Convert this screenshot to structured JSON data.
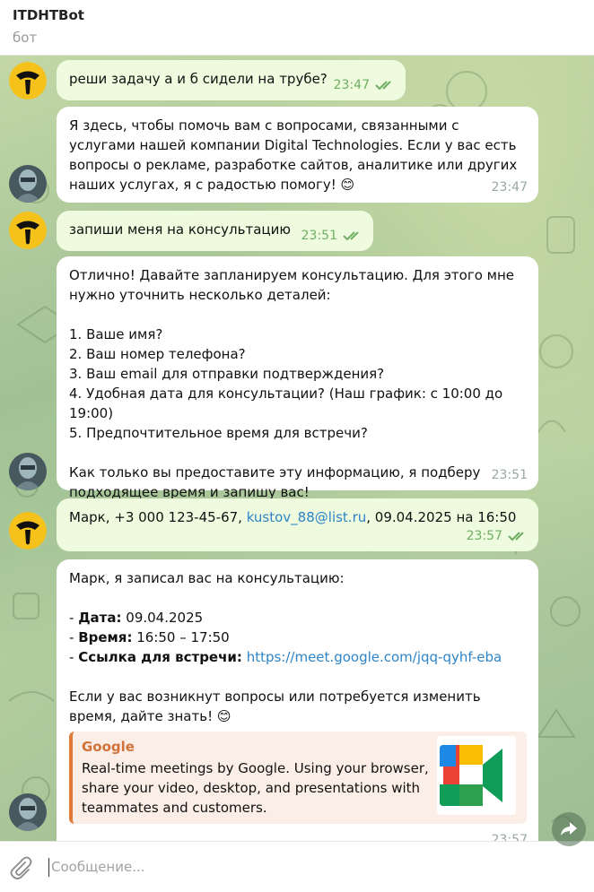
{
  "header": {
    "title": "ITDHTBot",
    "subtitle": "бот"
  },
  "messages": [
    {
      "from": "user",
      "text": "реши задачу а и б сидели на трубе?",
      "time": "23:47"
    },
    {
      "from": "bot",
      "text": "Я здесь, чтобы помочь вам с вопросами, связанными с услугами нашей компании Digital Technologies. Если у вас есть вопросы о рекламе, разработке сайтов, аналитике или других наших услугах, я с радостью помогу!",
      "emoji": "😊",
      "time": "23:47"
    },
    {
      "from": "user",
      "text": "запиши меня на консультацию",
      "time": "23:51"
    },
    {
      "from": "bot",
      "text": "Отлично! Давайте запланируем консультацию. Для этого мне нужно уточнить несколько деталей:\n\n1. Ваше имя?\n2. Ваш номер телефона?\n3. Ваш email для отправки подтверждения?\n4. Удобная дата для консультации? (Наш график: с 10:00 до 19:00)\n5. Предпочтительное время для встречи?\n\nКак только вы предоставите эту информацию, я подберу подходящее время и запишу вас!",
      "time": "23:51"
    },
    {
      "from": "user",
      "text_before": "Марк, +3 000 123-45-67, ",
      "link": "kustov_88@list.ru",
      "text_after": ", 09.04.2025 на 16:50",
      "time": "23:57"
    },
    {
      "from": "bot",
      "intro": "Марк, я записал вас на консультацию:",
      "items": [
        {
          "label": "Дата",
          "value": "09.04.2025"
        },
        {
          "label": "Время",
          "value": "16:50 – 17:50"
        },
        {
          "label": "Ссылка для встречи",
          "value": "https://meet.google.com/jqq-qyhf-eba"
        }
      ],
      "outro": "Если у вас возникнут вопросы или потребуется изменить время, дайте знать!",
      "emoji": "😊",
      "preview": {
        "site": "Google",
        "description": "Real-time meetings by Google. Using your browser, share your video, desktop, and presentations with teammates and customers."
      },
      "time": "23:57"
    }
  ],
  "composer": {
    "placeholder": "Сообщение..."
  },
  "icons": {
    "attach": "paperclip-icon",
    "forward": "share-arrow-icon",
    "read": "double-check-icon",
    "meet": "google-meet-icon"
  },
  "colors": {
    "outgoing_bubble": "#eefbde",
    "link": "#2e84c7",
    "preview_accent": "#e07b3a",
    "check": "#6fae63"
  }
}
